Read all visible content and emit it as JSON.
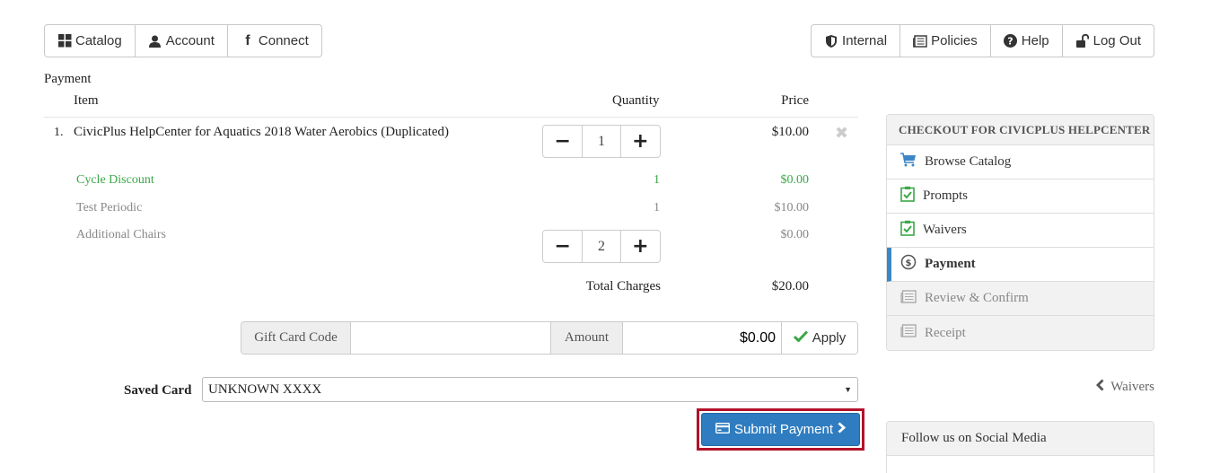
{
  "nav_left": [
    {
      "label": "Catalog",
      "icon": "grid-icon"
    },
    {
      "label": "Account",
      "icon": "user-icon"
    },
    {
      "label": "Connect",
      "icon": "facebook-icon"
    }
  ],
  "nav_right": [
    {
      "label": "Internal",
      "icon": "shield-icon"
    },
    {
      "label": "Policies",
      "icon": "newspaper-icon"
    },
    {
      "label": "Help",
      "icon": "question-icon"
    },
    {
      "label": "Log Out",
      "icon": "unlock-icon"
    }
  ],
  "page": {
    "title": "Payment"
  },
  "table": {
    "headers": {
      "item": "Item",
      "quantity": "Quantity",
      "price": "Price"
    },
    "item": {
      "number": "1.",
      "name": "CivicPlus HelpCenter for Aquatics 2018 Water Aerobics (Duplicated)",
      "quantity": "1",
      "price": "$10.00"
    },
    "sub_rows": [
      {
        "label": "Cycle Discount",
        "quantity": "1",
        "price": "$0.00"
      },
      {
        "label": "Test Periodic",
        "quantity": "1",
        "price": "$10.00"
      },
      {
        "label": "Additional Chairs",
        "quantity": "2",
        "price": "$0.00"
      }
    ],
    "total_label": "Total Charges",
    "total_value": "$20.00"
  },
  "gift_card": {
    "code_label": "Gift Card Code",
    "code_value": "",
    "amount_label": "Amount",
    "amount_value": "$0.00",
    "apply_label": "Apply"
  },
  "saved_card": {
    "label": "Saved Card",
    "selected": "UNKNOWN XXXX"
  },
  "submit_label": "Submit Payment",
  "sidebar": {
    "title": "CHECKOUT FOR CIVICPLUS HELPCENTER",
    "items": [
      {
        "label": "Browse Catalog",
        "icon": "cart-icon"
      },
      {
        "label": "Prompts",
        "icon": "clipboard-check-icon"
      },
      {
        "label": "Waivers",
        "icon": "clipboard-check-icon"
      },
      {
        "label": "Payment",
        "icon": "dollar-circle-icon"
      },
      {
        "label": "Review & Confirm",
        "icon": "newspaper-icon"
      },
      {
        "label": "Receipt",
        "icon": "newspaper-icon"
      }
    ]
  },
  "back_link": "Waivers",
  "social": {
    "title": "Follow us on Social Media"
  },
  "colors": {
    "accent": "#2f7dc0",
    "highlight": "#b3122a",
    "discount": "#3aa847",
    "active_bar": "#3d86c6"
  }
}
